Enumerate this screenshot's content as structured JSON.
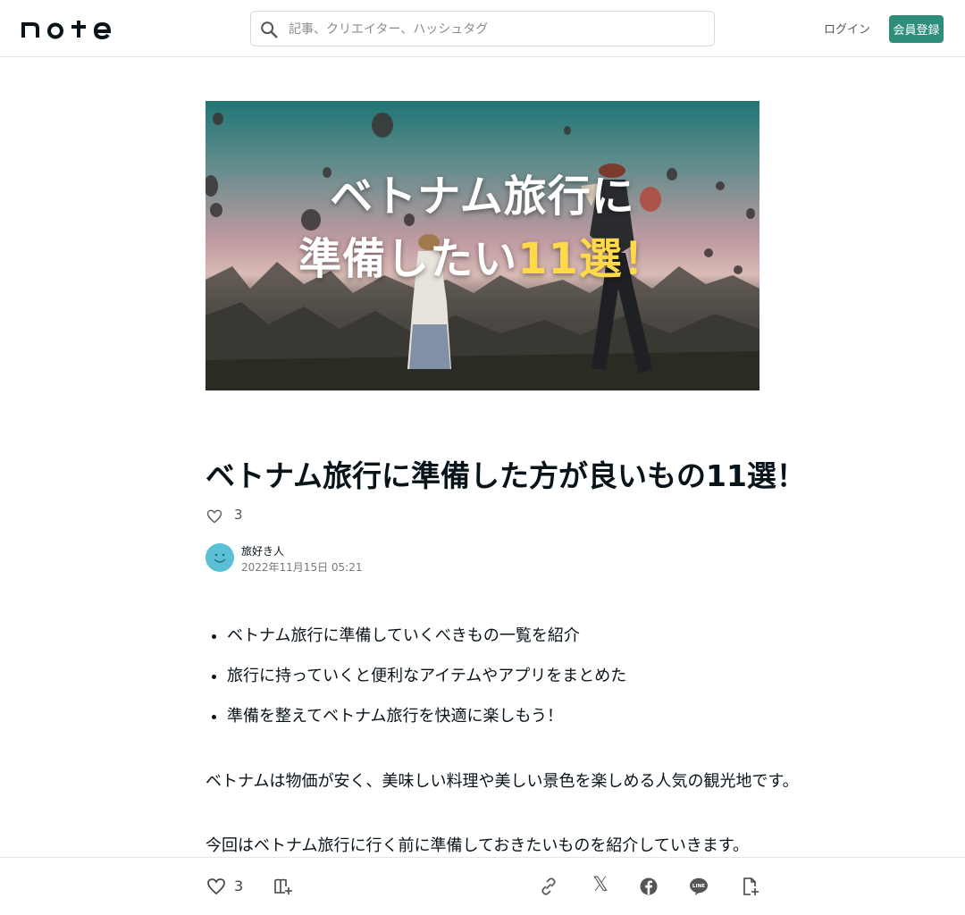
{
  "header": {
    "logo_text": "note",
    "search_placeholder": "記事、クリエイター、ハッシュタグ",
    "login_label": "ログイン",
    "signup_label": "会員登録"
  },
  "hero": {
    "line1": "ベトナム旅行に",
    "line2_pre": "準備したい",
    "line2_accent": "11",
    "line2_post": "選！",
    "accent_color": "#ffd94a"
  },
  "article": {
    "title": "ベトナム旅行に準備した方が良いもの11選！",
    "like_count": "3",
    "author_name": "旅好き人",
    "date": "2022年11月15日 05:21",
    "bullets": [
      "ベトナム旅行に準備していくべきもの一覧を紹介",
      "旅行に持っていくと便利なアイテムやアプリをまとめた",
      "準備を整えてベトナム旅行を快適に楽しもう！"
    ],
    "paragraphs": [
      "ベトナムは物価が安く、美味しい料理や美しい景色を楽しめる人気の観光地です。",
      "今回はベトナム旅行に行く前に準備しておきたいものを紹介していきます。"
    ]
  },
  "footer": {
    "like_count": "3",
    "x_glyph": "𝕏"
  },
  "colors": {
    "brand": "#2d8e7c",
    "text": "#08131a",
    "avatar": "#5bbfd6"
  }
}
